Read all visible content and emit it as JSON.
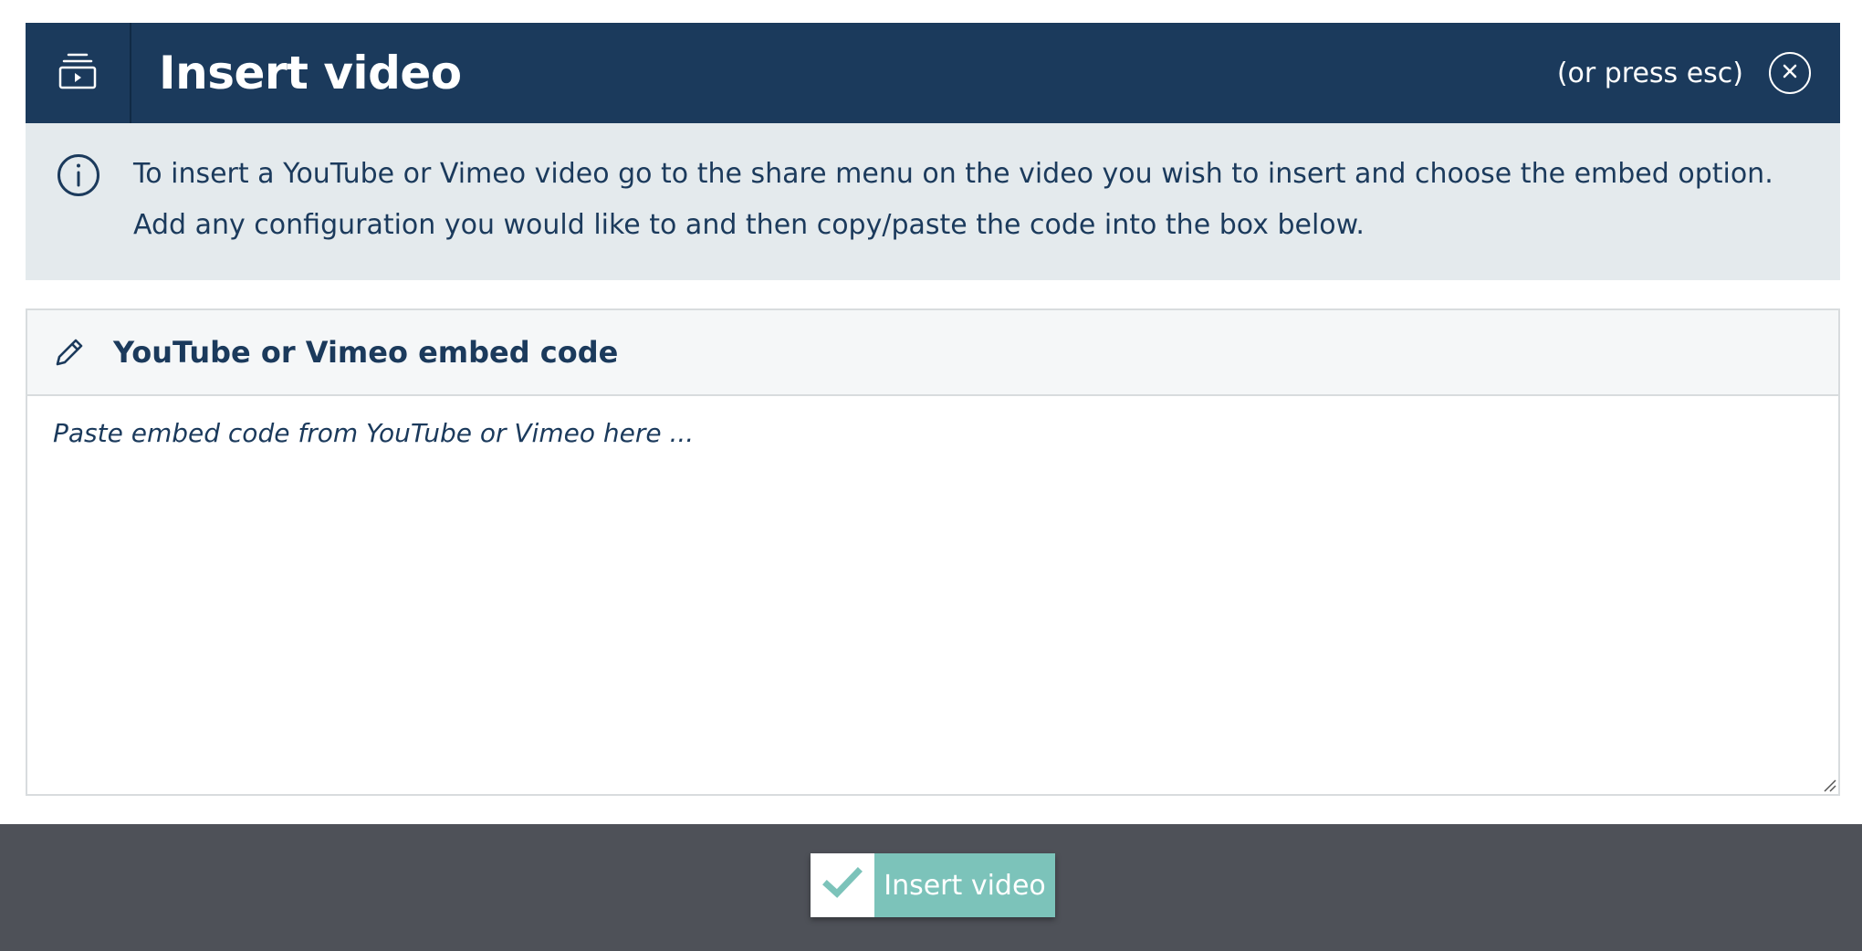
{
  "dialog": {
    "title": "Insert video",
    "esc_hint": "(or press esc)",
    "header_icon": "video-stack-icon",
    "close_icon": "close-icon"
  },
  "info": {
    "icon": "info-icon",
    "text": "To insert a YouTube or Vimeo video go to the share menu on the video you wish to insert and choose the embed option. Add any configuration you would like to and then copy/paste the code into the box below."
  },
  "embed": {
    "icon": "pencil-icon",
    "title": "YouTube or Vimeo embed code",
    "placeholder": "Paste embed code from YouTube or Vimeo here ...",
    "value": ""
  },
  "footer": {
    "submit_label": "Insert video",
    "submit_icon": "checkmark-icon"
  },
  "colors": {
    "header_bg": "#1b3a5c",
    "info_bg": "#e4eaed",
    "footer_bg": "#4e5158",
    "accent": "#7cc3ba"
  }
}
